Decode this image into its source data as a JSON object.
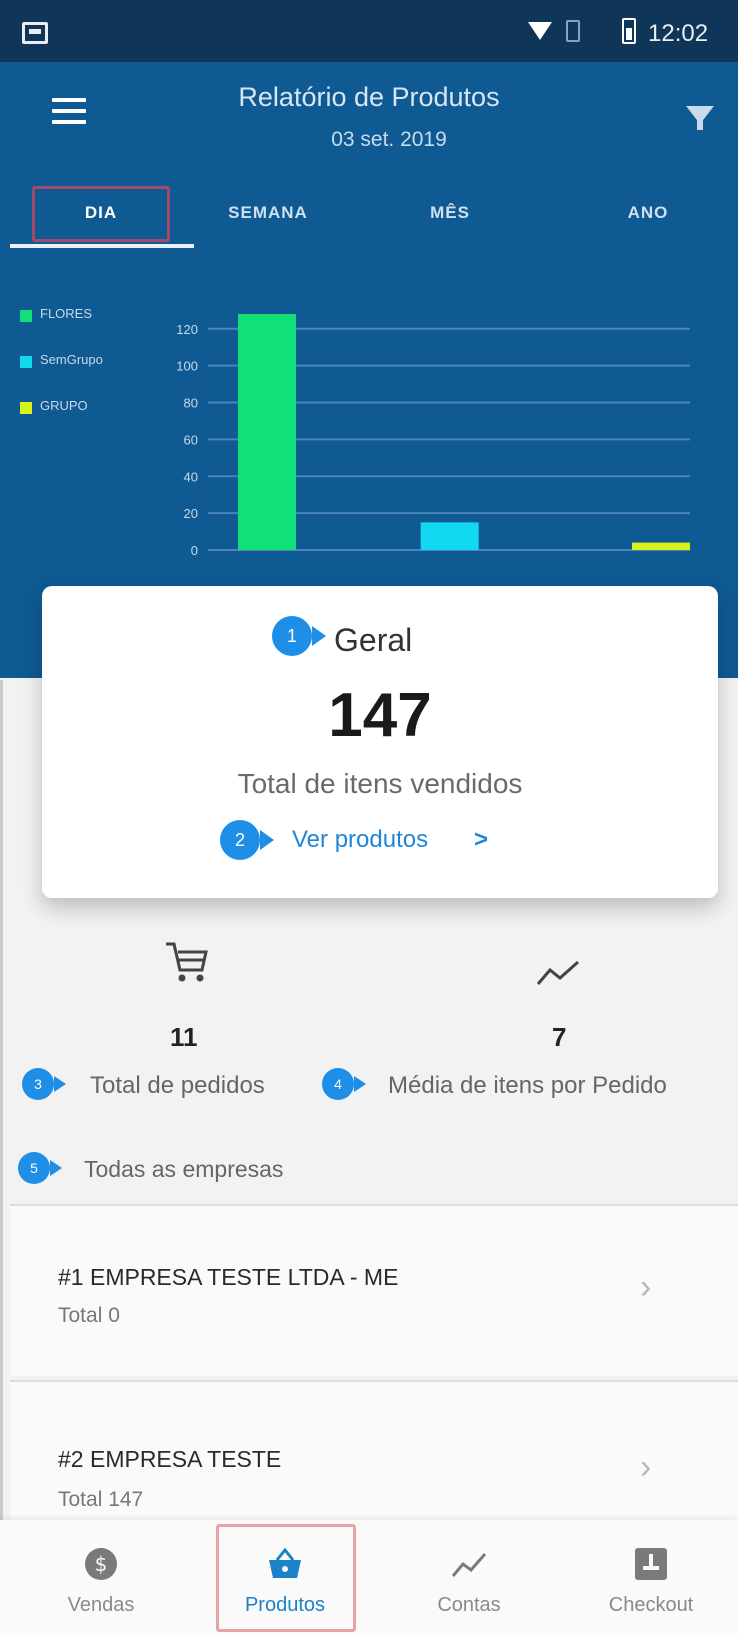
{
  "status_bar": {
    "time": "12:02"
  },
  "header": {
    "title": "Relatório de Produtos",
    "subtitle": "03 set. 2019"
  },
  "tabs": [
    {
      "label": "DIA",
      "active": true
    },
    {
      "label": "SEMANA",
      "active": false
    },
    {
      "label": "MÊS",
      "active": false
    },
    {
      "label": "ANO",
      "active": false
    }
  ],
  "chart_data": {
    "type": "bar",
    "categories": [
      "FLORES",
      "SemGrupo",
      "GRUPO"
    ],
    "series": [
      {
        "name": "FLORES",
        "color": "#11e07a",
        "values": [
          128,
          null,
          null
        ]
      },
      {
        "name": "SemGrupo",
        "color": "#12d8f2",
        "values": [
          null,
          15,
          null
        ]
      },
      {
        "name": "GRUPO",
        "color": "#d9f21a",
        "values": [
          null,
          null,
          4
        ]
      }
    ],
    "ylim": [
      0,
      128
    ],
    "yticks": [
      0,
      20,
      40,
      60,
      80,
      100,
      120
    ],
    "grid": true,
    "legend_position": "left"
  },
  "card": {
    "badge": "1",
    "heading": "Geral",
    "total_value": "147",
    "total_label": "Total de itens vendidos",
    "link_badge": "2",
    "link_label": "Ver produtos",
    "link_chevron": ">"
  },
  "stats": [
    {
      "icon": "cart-icon",
      "value": "11",
      "badge": "3",
      "label": "Total de pedidos"
    },
    {
      "icon": "trend-icon",
      "value": "7",
      "badge": "4",
      "label": "Média de itens por Pedido"
    }
  ],
  "companies_filter": {
    "badge": "5",
    "label": "Todas as empresas"
  },
  "companies": [
    {
      "name": "#1 EMPRESA TESTE LTDA - ME",
      "total": "Total 0"
    },
    {
      "name": "#2 EMPRESA TESTE",
      "total": "Total 147"
    }
  ],
  "bottom_nav": [
    {
      "label": "Vendas",
      "icon": "money-icon",
      "active": false
    },
    {
      "label": "Produtos",
      "icon": "basket-icon",
      "active": true
    },
    {
      "label": "Contas",
      "icon": "trend-icon",
      "active": false
    },
    {
      "label": "Checkout",
      "icon": "checkout-icon",
      "active": false
    }
  ]
}
